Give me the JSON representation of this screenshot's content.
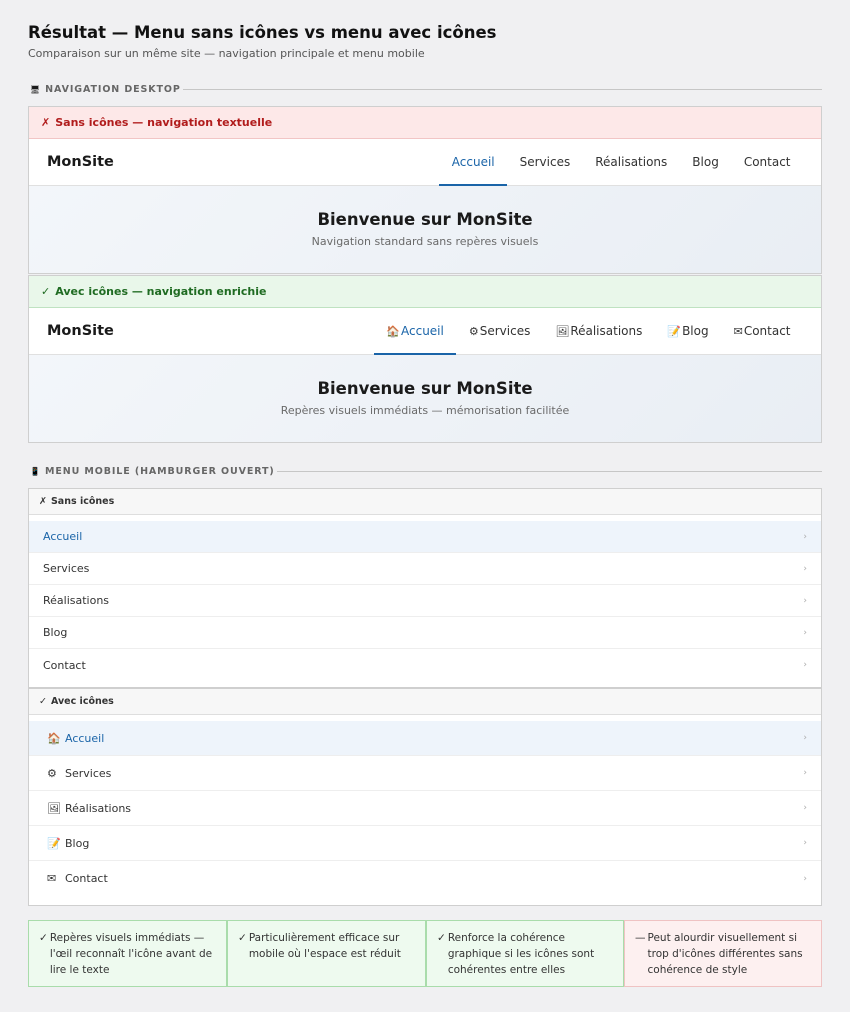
{
  "header": {
    "title": "Résultat — Menu sans icônes vs menu avec icônes",
    "subtitle": "Comparaison sur un même site — navigation principale et menu mobile"
  },
  "desktop_section": {
    "icon": "🖥",
    "label": "NAVIGATION DESKTOP"
  },
  "desktop_without": {
    "mark": "✗",
    "header": "Sans icônes — navigation textuelle",
    "brand": "MonSite",
    "nav": [
      {
        "label": "Accueil",
        "active": true
      },
      {
        "label": "Services"
      },
      {
        "label": "Réalisations"
      },
      {
        "label": "Blog"
      },
      {
        "label": "Contact"
      }
    ],
    "hero_title": "Bienvenue sur MonSite",
    "hero_sub": "Navigation standard sans repères visuels"
  },
  "desktop_with": {
    "mark": "✓",
    "header": "Avec icônes — navigation enrichie",
    "brand": "MonSite",
    "nav": [
      {
        "icon": "🏠",
        "label": "Accueil",
        "active": true
      },
      {
        "icon": "⚙",
        "label": "Services"
      },
      {
        "icon": "🖼",
        "label": "Réalisations"
      },
      {
        "icon": "📝",
        "label": "Blog"
      },
      {
        "icon": "✉",
        "label": "Contact"
      }
    ],
    "hero_title": "Bienvenue sur MonSite",
    "hero_sub": "Repères visuels immédiats — mémorisation facilitée"
  },
  "mobile_section": {
    "icon": "📱",
    "label": "MENU MOBILE (HAMBURGER OUVERT)"
  },
  "mobile_without": {
    "mark": "✗",
    "header": "Sans icônes",
    "items": [
      {
        "label": "Accueil",
        "active": true
      },
      {
        "label": "Services"
      },
      {
        "label": "Réalisations"
      },
      {
        "label": "Blog"
      },
      {
        "label": "Contact"
      }
    ]
  },
  "mobile_with": {
    "mark": "✓",
    "header": "Avec icônes",
    "items": [
      {
        "icon": "🏠",
        "label": "Accueil",
        "active": true
      },
      {
        "icon": "⚙",
        "label": "Services"
      },
      {
        "icon": "🖼",
        "label": "Réalisations"
      },
      {
        "icon": "📝",
        "label": "Blog"
      },
      {
        "icon": "✉",
        "label": "Contact"
      }
    ]
  },
  "chevron": "›",
  "cards": [
    {
      "type": "pro",
      "mark": "✓",
      "text": "Repères visuels immédiats — l'œil reconnaît l'icône avant de lire le texte"
    },
    {
      "type": "pro",
      "mark": "✓",
      "text": "Particulièrement efficace sur mobile où l'espace est réduit"
    },
    {
      "type": "pro",
      "mark": "✓",
      "text": "Renforce la cohérence graphique si les icônes sont cohérentes entre elles"
    },
    {
      "type": "con",
      "mark": "—",
      "text": "Peut alourdir visuellement si trop d'icônes différentes sans cohérence de style"
    }
  ],
  "colors": {
    "accent": "#1a64a8",
    "bad": "#b11c1c",
    "good": "#1f6b22"
  }
}
